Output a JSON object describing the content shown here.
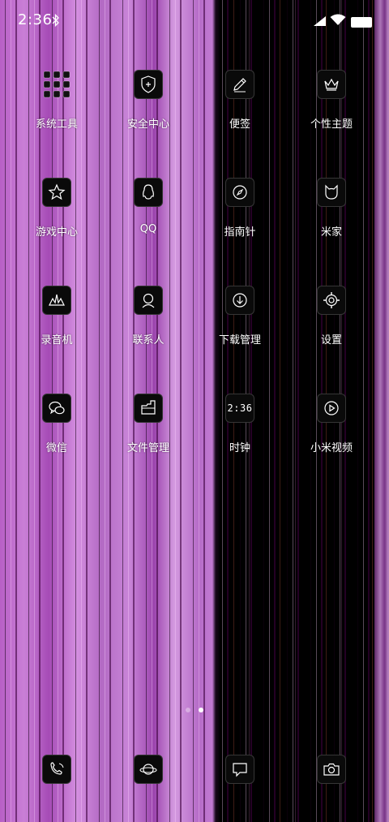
{
  "status_bar": {
    "time": "2:36",
    "icons": [
      "bluetooth-icon",
      "signal-icon",
      "wifi-icon",
      "battery-icon"
    ]
  },
  "apps": [
    {
      "label": "系统工具",
      "icon": "folder-grid-icon"
    },
    {
      "label": "安全中心",
      "icon": "shield-plus-icon"
    },
    {
      "label": "便签",
      "icon": "pencil-icon"
    },
    {
      "label": "个性主题",
      "icon": "crown-icon"
    },
    {
      "label": "游戏中心",
      "icon": "star-icon"
    },
    {
      "label": "QQ",
      "icon": "penguin-icon"
    },
    {
      "label": "指南针",
      "icon": "compass-icon"
    },
    {
      "label": "米家",
      "icon": "cat-icon"
    },
    {
      "label": "录音机",
      "icon": "waveform-icon"
    },
    {
      "label": "联系人",
      "icon": "person-icon"
    },
    {
      "label": "下载管理",
      "icon": "download-icon"
    },
    {
      "label": "设置",
      "icon": "gear-icon"
    },
    {
      "label": "微信",
      "icon": "chat-bubbles-icon"
    },
    {
      "label": "文件管理",
      "icon": "folder-icon"
    },
    {
      "label": "时钟",
      "icon": "clock-icon",
      "tile_text": "2:36"
    },
    {
      "label": "小米视频",
      "icon": "play-icon"
    }
  ],
  "page_indicator": {
    "count": 2,
    "active": 2
  },
  "dock": [
    {
      "icon": "phone-icon"
    },
    {
      "icon": "browser-planet-icon"
    },
    {
      "icon": "message-icon"
    },
    {
      "icon": "camera-icon"
    }
  ],
  "colors": {
    "wallpaper_pink": "#c27ad2",
    "wallpaper_dark": "#000000",
    "icon_tile": "#0a0a0a",
    "text": "#ffffff"
  }
}
